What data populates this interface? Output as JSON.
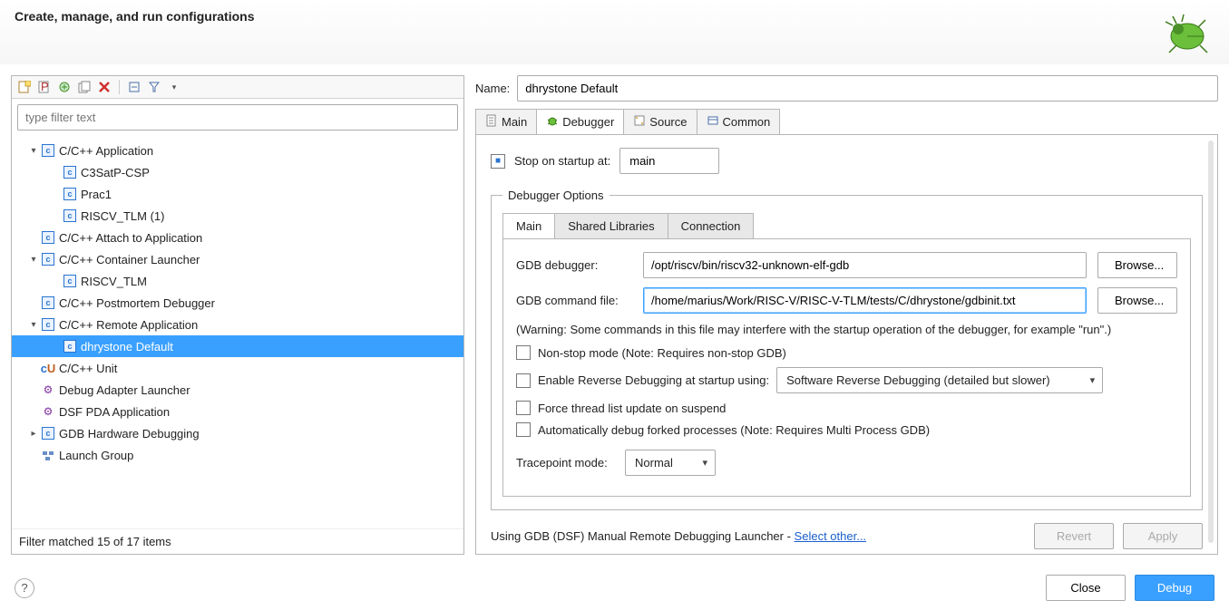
{
  "header": {
    "title": "Create, manage, and run configurations"
  },
  "toolbar": {
    "filter_placeholder": "type filter text"
  },
  "tree": {
    "items": [
      {
        "label": "C/C++ Application",
        "expandable": true,
        "expanded": true,
        "icon": "c"
      },
      {
        "label": "C3SatP-CSP",
        "indent": 2,
        "icon": "c"
      },
      {
        "label": "Prac1",
        "indent": 2,
        "icon": "c"
      },
      {
        "label": "RISCV_TLM (1)",
        "indent": 2,
        "icon": "c"
      },
      {
        "label": "C/C++ Attach to Application",
        "icon": "c"
      },
      {
        "label": "C/C++ Container Launcher",
        "expandable": true,
        "expanded": true,
        "icon": "c"
      },
      {
        "label": "RISCV_TLM",
        "indent": 2,
        "icon": "c"
      },
      {
        "label": "C/C++ Postmortem Debugger",
        "icon": "c"
      },
      {
        "label": "C/C++ Remote Application",
        "expandable": true,
        "expanded": true,
        "icon": "c"
      },
      {
        "label": "dhrystone Default",
        "indent": 2,
        "selected": true,
        "icon": "c"
      },
      {
        "label": "C/C++ Unit",
        "icon": "cu"
      },
      {
        "label": "Debug Adapter Launcher",
        "icon": "bug"
      },
      {
        "label": "DSF PDA Application",
        "icon": "bug"
      },
      {
        "label": "GDB Hardware Debugging",
        "expandable": true,
        "expanded": false,
        "icon": "c"
      },
      {
        "label": "Launch Group",
        "icon": "group"
      }
    ],
    "status": "Filter matched 15 of 17 items"
  },
  "right": {
    "name_label": "Name:",
    "name_value": "dhrystone Default",
    "tabs": [
      {
        "label": "Main",
        "icon": "doc"
      },
      {
        "label": "Debugger",
        "icon": "bug",
        "active": true
      },
      {
        "label": "Source",
        "icon": "src"
      },
      {
        "label": "Common",
        "icon": "common"
      }
    ],
    "stop_on_startup": {
      "label": "Stop on startup at:",
      "value": "main",
      "checked": true
    },
    "debugger_options": {
      "legend": "Debugger Options",
      "tabs": [
        {
          "label": "Main",
          "active": true
        },
        {
          "label": "Shared Libraries"
        },
        {
          "label": "Connection"
        }
      ],
      "gdb_debugger": {
        "label": "GDB debugger:",
        "value": "/opt/riscv/bin/riscv32-unknown-elf-gdb",
        "browse": "Browse..."
      },
      "gdb_command_file": {
        "label": "GDB command file:",
        "value": "/home/marius/Work/RISC-V/RISC-V-TLM/tests/C/dhrystone/gdbinit.txt",
        "browse": "Browse..."
      },
      "warning": "(Warning: Some commands in this file may interfere with the startup operation of the debugger, for example \"run\".)",
      "nonstop": {
        "label": "Non-stop mode (Note: Requires non-stop GDB)",
        "checked": false
      },
      "reverse": {
        "label": "Enable Reverse Debugging at startup using:",
        "checked": false,
        "select_value": "Software Reverse Debugging (detailed but slower)"
      },
      "force_thread": {
        "label": "Force thread list update on suspend",
        "checked": false
      },
      "auto_fork": {
        "label": "Automatically debug forked processes (Note: Requires Multi Process GDB)",
        "checked": false
      },
      "tracepoint": {
        "label": "Tracepoint mode:",
        "value": "Normal"
      }
    },
    "launcher": {
      "text": "Using GDB (DSF) Manual Remote Debugging Launcher - ",
      "link": "Select other..."
    },
    "buttons": {
      "revert": "Revert",
      "apply": "Apply"
    }
  },
  "footer": {
    "close": "Close",
    "debug": "Debug"
  }
}
